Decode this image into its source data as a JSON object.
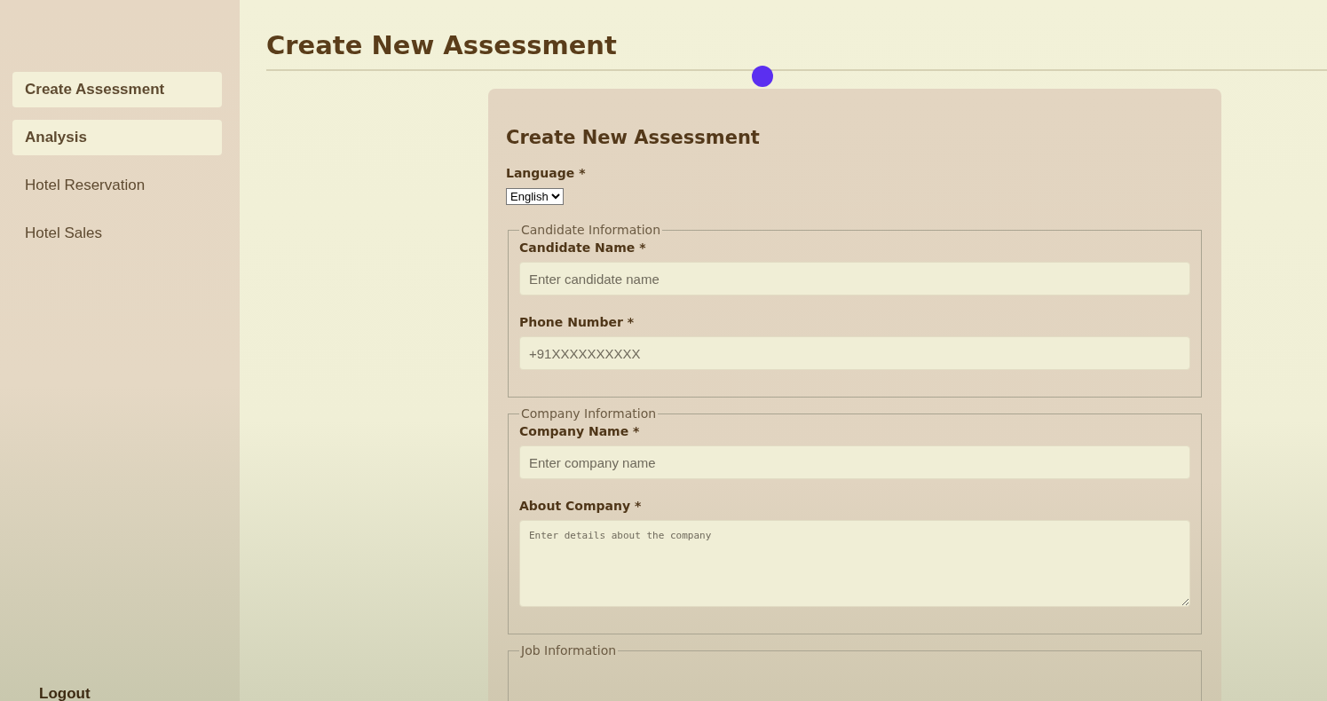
{
  "sidebar": {
    "items": [
      {
        "label": "Create Assessment",
        "selected": true
      },
      {
        "label": "Analysis",
        "selected": true
      },
      {
        "label": "Hotel Reservation",
        "selected": false
      },
      {
        "label": "Hotel Sales",
        "selected": false
      }
    ],
    "logout": "Logout"
  },
  "page": {
    "title": "Create New Assessment"
  },
  "form": {
    "title": "Create New Assessment",
    "language": {
      "label": "Language *",
      "value": "English"
    },
    "sections": [
      {
        "legend": "Candidate Information",
        "fields": [
          {
            "kind": "input",
            "label": "Candidate Name *",
            "placeholder": "Enter candidate name"
          },
          {
            "kind": "input",
            "label": "Phone Number *",
            "placeholder": "+91XXXXXXXXXX"
          }
        ]
      },
      {
        "legend": "Company Information",
        "fields": [
          {
            "kind": "input",
            "label": "Company Name *",
            "placeholder": "Enter company name"
          },
          {
            "kind": "textarea",
            "label": "About Company *",
            "placeholder": "Enter details about the company"
          }
        ]
      },
      {
        "legend": "Job Information"
      }
    ]
  }
}
